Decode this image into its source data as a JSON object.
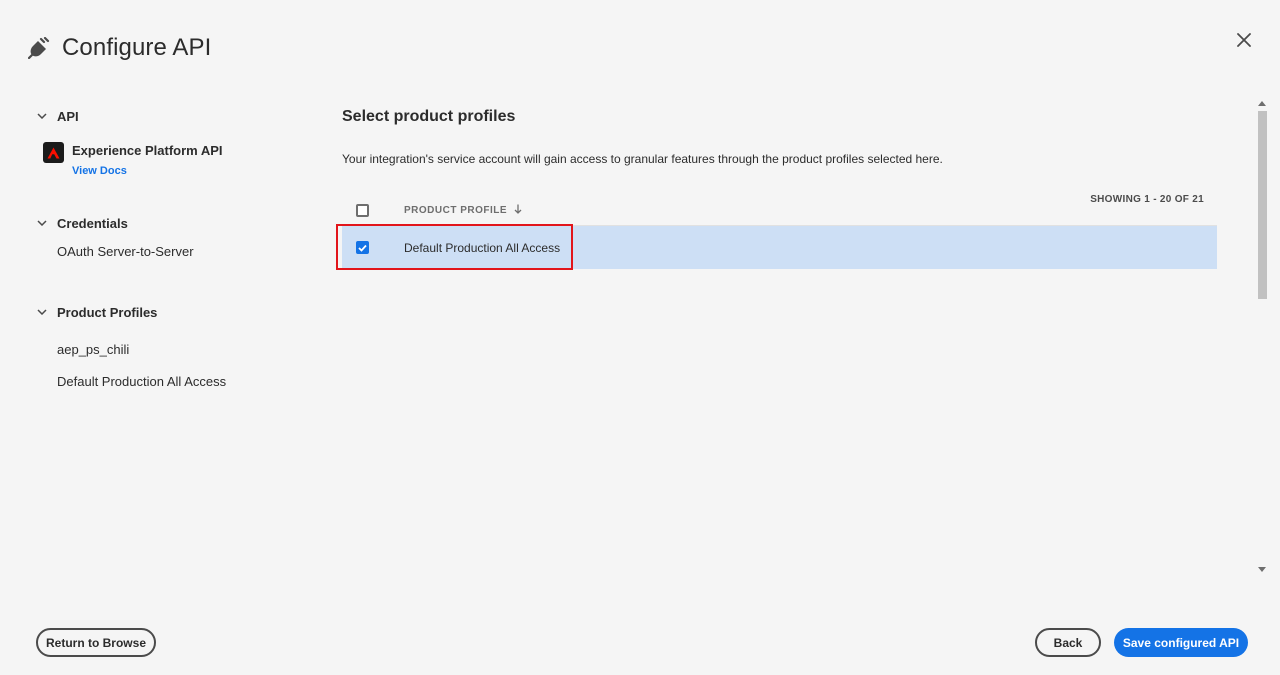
{
  "header": {
    "title": "Configure API",
    "icon": "plug-icon"
  },
  "nav": {
    "api_heading": "API",
    "api_name": "Experience Platform API",
    "view_docs": "View Docs",
    "credentials_heading": "Credentials",
    "credential_item": "OAuth Server-to-Server",
    "profiles_heading": "Product Profiles",
    "profile_items": [
      "aep_ps_chili",
      "Default Production All Access"
    ]
  },
  "main": {
    "heading": "Select product profiles",
    "description": "Your integration's service account will gain access to granular features through the product profiles selected here.",
    "showing": "SHOWING 1 - 20 OF 21",
    "column_header": "PRODUCT PROFILE",
    "rows": [
      {
        "name": "Default Production All Access",
        "checked": true
      }
    ]
  },
  "footer": {
    "return_label": "Return to Browse",
    "back_label": "Back",
    "save_label": "Save configured API"
  },
  "colors": {
    "accent": "#1473e6",
    "selected_row": "#cddff5",
    "highlight": "#e2151b",
    "background": "#f5f5f5"
  }
}
